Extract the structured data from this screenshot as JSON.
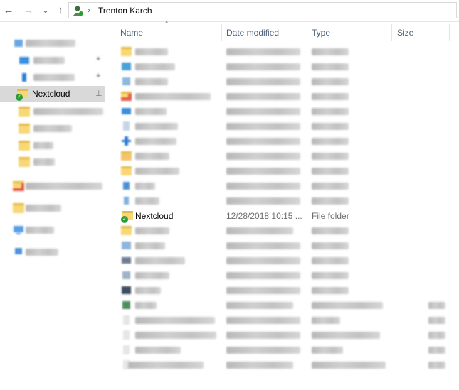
{
  "toolbar": {
    "back": "←",
    "forward": "→",
    "recent": "⌄",
    "up": "↑"
  },
  "address": {
    "separator": "›",
    "crumb": "Trenton Karch"
  },
  "sidebar": {
    "selected_label": "Nextcloud",
    "pin_glyph": "📌"
  },
  "columns": {
    "name": "Name",
    "date": "Date modified",
    "type": "Type",
    "size": "Size",
    "sort_glyph": "^"
  },
  "rows": {
    "nextcloud": {
      "name": "Nextcloud",
      "date": "12/28/2018 10:15 ...",
      "type": "File folder"
    }
  },
  "colors": {
    "selected_bg": "#d9d9d9",
    "folder": "#f8d775",
    "sync_ok": "#2e9b3a",
    "header_text": "#4c607a"
  }
}
